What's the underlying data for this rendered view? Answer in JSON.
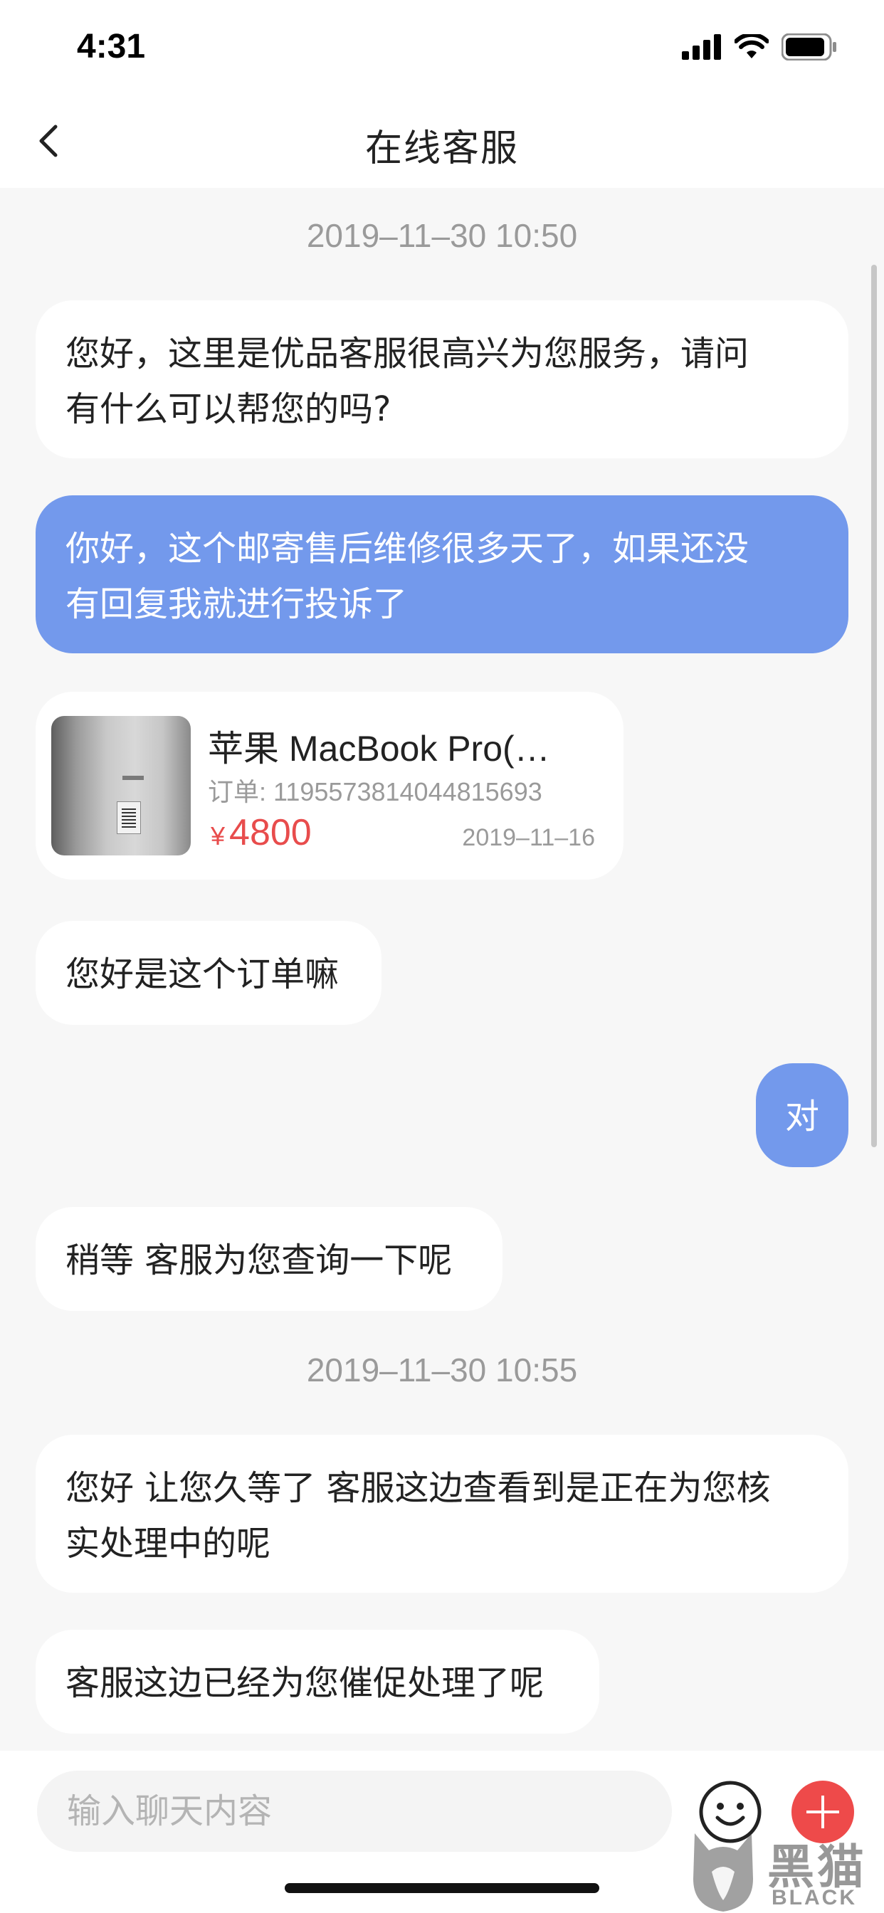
{
  "status_bar": {
    "time": "4:31",
    "icons": [
      "signal-icon",
      "wifi-icon",
      "battery-icon"
    ]
  },
  "nav": {
    "title": "在线客服",
    "back_icon": "chevron-left-icon"
  },
  "messages": {
    "ts1": "2019–11–30 10:50",
    "m1": [
      "您好，这里是优品客服很高兴为您服务，请问",
      "有什么可以帮您的吗?"
    ],
    "m2": [
      "你好，这个邮寄售后维修很多天了，如果还没",
      "有回复我就进行投诉了"
    ],
    "m3": "您好是这个订单嘛",
    "m4": "对",
    "m5": "稍等 客服为您查询一下呢",
    "ts2": "2019–11–30 10:55",
    "m6": [
      "您好 让您久等了 客服这边查看到是正在为您核",
      "实处理中的呢"
    ],
    "m7": "客服这边已经为您催促处理了呢"
  },
  "product": {
    "title": "苹果 MacBook Pro(…",
    "order": "订单: 1195573814044815693",
    "currency": "¥",
    "price": "4800",
    "date": "2019–11–16"
  },
  "input": {
    "placeholder": "输入聊天内容",
    "emoji_icon": "emoji-icon",
    "add_icon": "plus-icon"
  },
  "watermark": {
    "cn": "黑猫",
    "en": "BLACK CAT"
  },
  "colors": {
    "outgoing_bubble": "#7399ec",
    "incoming_bubble": "#ffffff",
    "price": "#e84c4c",
    "add_button": "#ee4a4a",
    "background": "#f7f7f7"
  }
}
